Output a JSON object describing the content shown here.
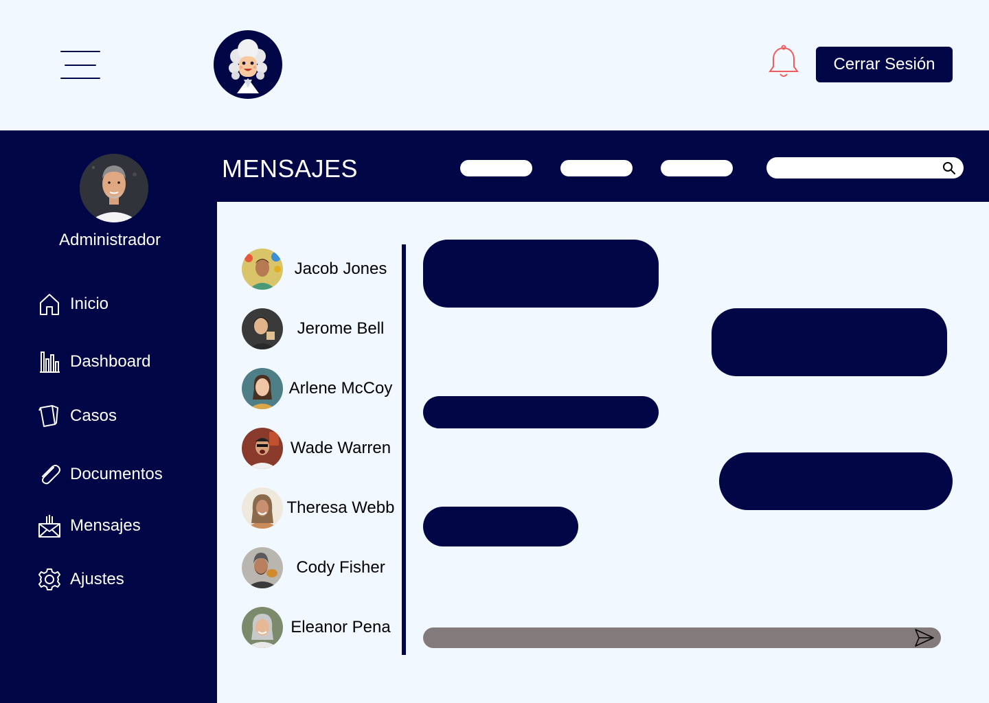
{
  "header": {
    "menu_icon": "hamburger-menu-icon",
    "logo_icon": "judge-wig-logo",
    "notification_icon": "bell-icon",
    "logout_label": "Cerrar Sesión"
  },
  "sidebar": {
    "user_name": "Administrador",
    "items": [
      {
        "label": "Inicio",
        "icon": "home-icon"
      },
      {
        "label": "Dashboard",
        "icon": "bar-chart-icon"
      },
      {
        "label": "Casos",
        "icon": "cards-icon"
      },
      {
        "label": "Documentos",
        "icon": "paperclip-icon"
      },
      {
        "label": "Mensajes",
        "icon": "envelope-icon"
      },
      {
        "label": "Ajustes",
        "icon": "gear-icon"
      }
    ]
  },
  "main": {
    "title": "MENSAJES",
    "search": {
      "placeholder": "",
      "icon": "search-icon"
    },
    "contacts": [
      {
        "name": "Jacob Jones"
      },
      {
        "name": "Jerome Bell"
      },
      {
        "name": "Arlene McCoy"
      },
      {
        "name": "Wade Warren"
      },
      {
        "name": "Theresa Webb"
      },
      {
        "name": "Cody Fisher"
      },
      {
        "name": "Eleanor Pena"
      }
    ],
    "composer": {
      "placeholder": "",
      "send_icon": "send-icon"
    }
  },
  "colors": {
    "primary": "#000646",
    "background": "#f2f8ff",
    "bell": "#f15b5b",
    "composer": "#837b7b"
  }
}
